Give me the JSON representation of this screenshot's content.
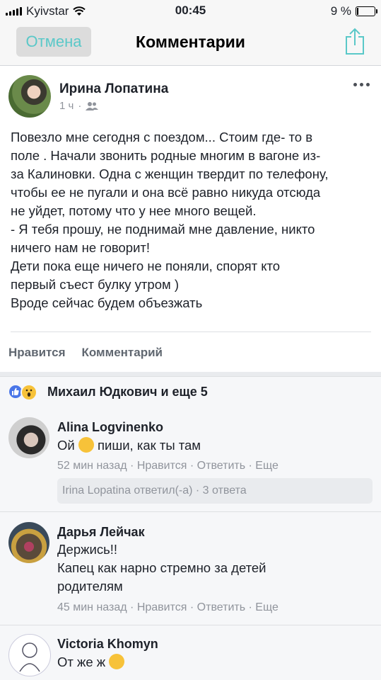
{
  "status_bar": {
    "carrier": "Kyivstar",
    "time": "00:45",
    "battery": "9 %",
    "battery_level": 0.09
  },
  "nav": {
    "cancel_label": "Отмена",
    "title": "Комментарии",
    "share_icon": "share-icon"
  },
  "post": {
    "author": "Ирина Лопатина",
    "time": "1 ч",
    "text_lines": [
      "Повезло мне сегодня с поездом... Стоим где- то в",
      "поле . Начали звонить родные многим в вагоне из-",
      "за Калиновки. Одна с женщин твердит по телефону,",
      "чтобы ее не пугали и она всё равно никуда отсюда",
      "не уйдет, потому что у нее много вещей.",
      "- Я тебя прошу, не поднимай мне давление, никто",
      "ничего нам не говорит!",
      "Дети пока еще ничего не поняли, спорят кто",
      "первый съест булку утром )",
      "Вроде сейчас будем объезжать"
    ],
    "like_label": "Нравится",
    "comment_label": "Комментарий"
  },
  "reactions": {
    "text": "Михаил Юдкович и еще 5",
    "like_color": "#4a76e8",
    "wow_color": "#f7c239"
  },
  "comments": [
    {
      "name": "Alina Logvinenko",
      "text_before": "Ой",
      "text_after": "пиши, как ты там",
      "time": "52 мин назад",
      "like": "Нравится",
      "reply": "Ответить",
      "more": "Еще",
      "replies_text": "Irina Lopatina ответил(-а) · 3 ответа"
    },
    {
      "name": "Дарья Лейчак",
      "lines": [
        "Держись!!",
        "Капец как нарно стремно за детей",
        "родителям"
      ],
      "time": "45 мин назад",
      "like": "Нравится",
      "reply": "Ответить",
      "more": "Еще"
    },
    {
      "name": "Victoria Khomyn",
      "text": "От же ж"
    }
  ],
  "dot": "·"
}
